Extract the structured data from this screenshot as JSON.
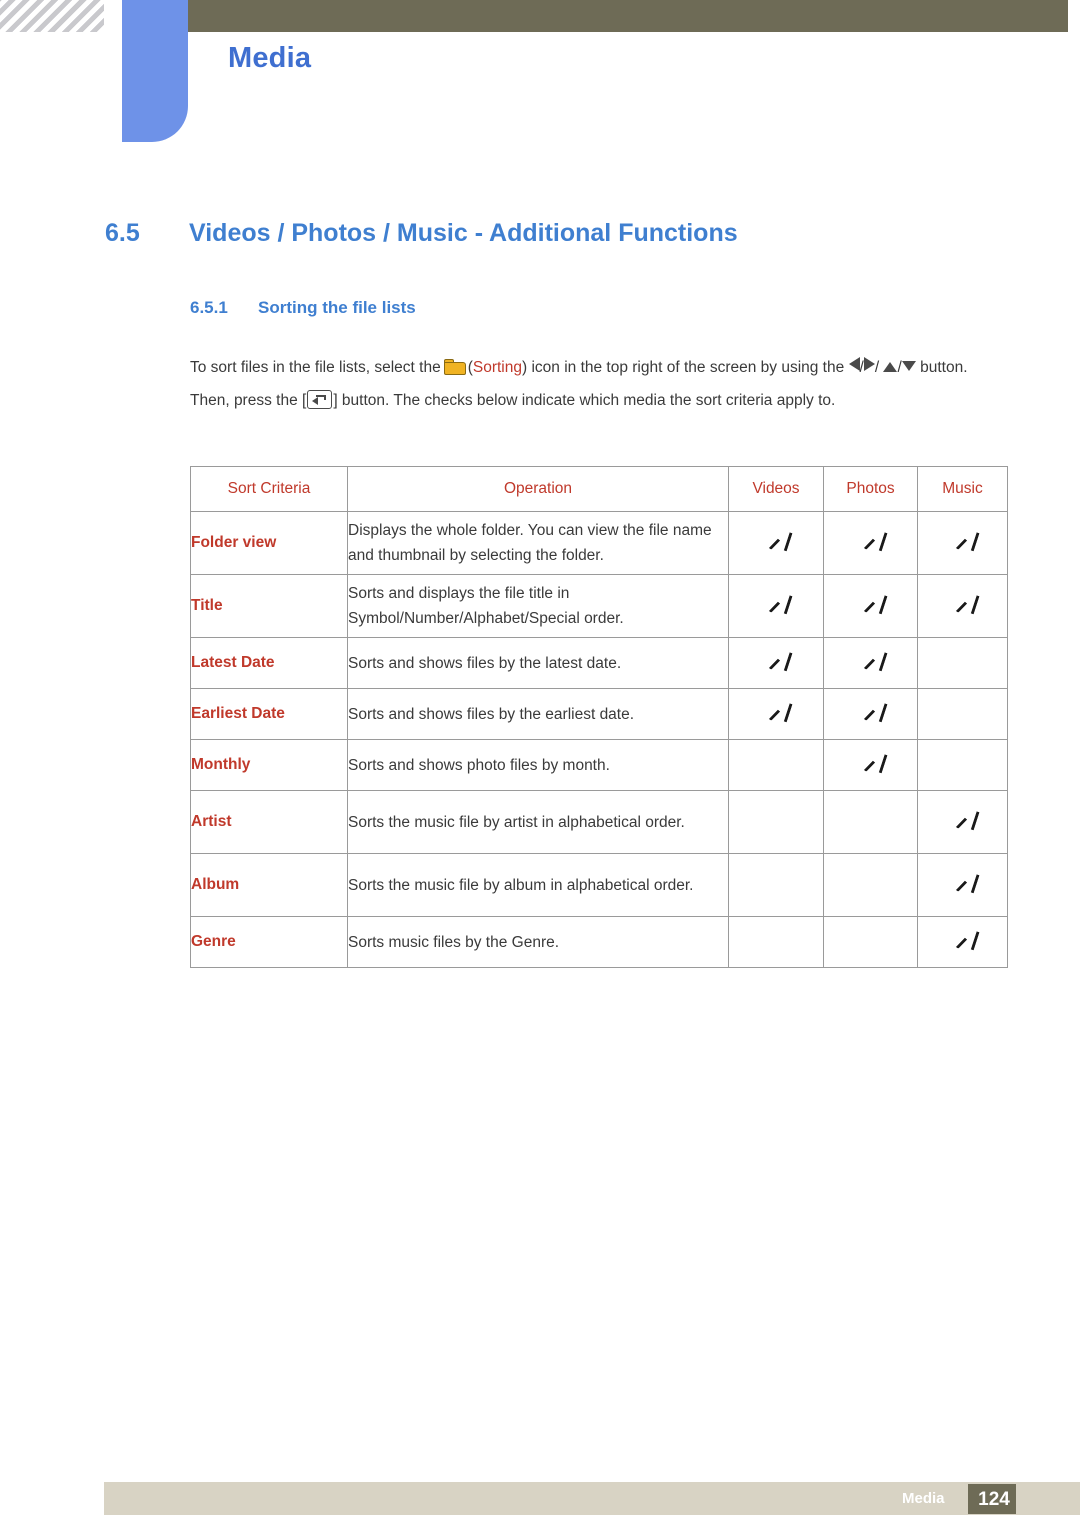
{
  "header": {
    "title": "Media"
  },
  "section": {
    "number": "6.5",
    "title": "Videos / Photos / Music - Additional Functions",
    "sub_number": "6.5.1",
    "sub_title": "Sorting the file lists"
  },
  "paragraph": {
    "part1": "To sort files in the file lists, select the",
    "open_paren": "(",
    "sorting_word": "Sorting",
    "part2": ") icon in the top right of the screen by using the",
    "slash": "/",
    "part3": "button. Then, press the [",
    "part4": "] button. The checks below indicate which media the sort criteria apply to."
  },
  "table": {
    "headers": [
      "Sort Criteria",
      "Operation",
      "Videos",
      "Photos",
      "Music"
    ],
    "rows": [
      {
        "criteria": "Folder view",
        "operation": "Displays the whole folder. You can view the file name and thumbnail by selecting the folder.",
        "videos": true,
        "photos": true,
        "music": true
      },
      {
        "criteria": "Title",
        "operation": "Sorts and displays the file title in Symbol/Number/Alphabet/Special order.",
        "videos": true,
        "photos": true,
        "music": true
      },
      {
        "criteria": "Latest Date",
        "operation": "Sorts and shows files by the latest date.",
        "videos": true,
        "photos": true,
        "music": false
      },
      {
        "criteria": "Earliest Date",
        "operation": "Sorts and shows files by the earliest date.",
        "videos": true,
        "photos": true,
        "music": false
      },
      {
        "criteria": "Monthly",
        "operation": "Sorts and shows photo files by month.",
        "videos": false,
        "photos": true,
        "music": false
      },
      {
        "criteria": "Artist",
        "operation": "Sorts the music file by artist in alphabetical order.",
        "videos": false,
        "photos": false,
        "music": true
      },
      {
        "criteria": "Album",
        "operation": "Sorts the music file by album in alphabetical order.",
        "videos": false,
        "photos": false,
        "music": true
      },
      {
        "criteria": "Genre",
        "operation": "Sorts music files by the Genre.",
        "videos": false,
        "photos": false,
        "music": true
      }
    ]
  },
  "footer": {
    "label": "Media",
    "page": "124"
  },
  "colors": {
    "heading_blue": "#3f7fd0",
    "criteria_red": "#c0392b",
    "header_olive": "#6e6b56",
    "tab_blue": "#6e92e8",
    "footer_beige": "#d8d3c4"
  }
}
